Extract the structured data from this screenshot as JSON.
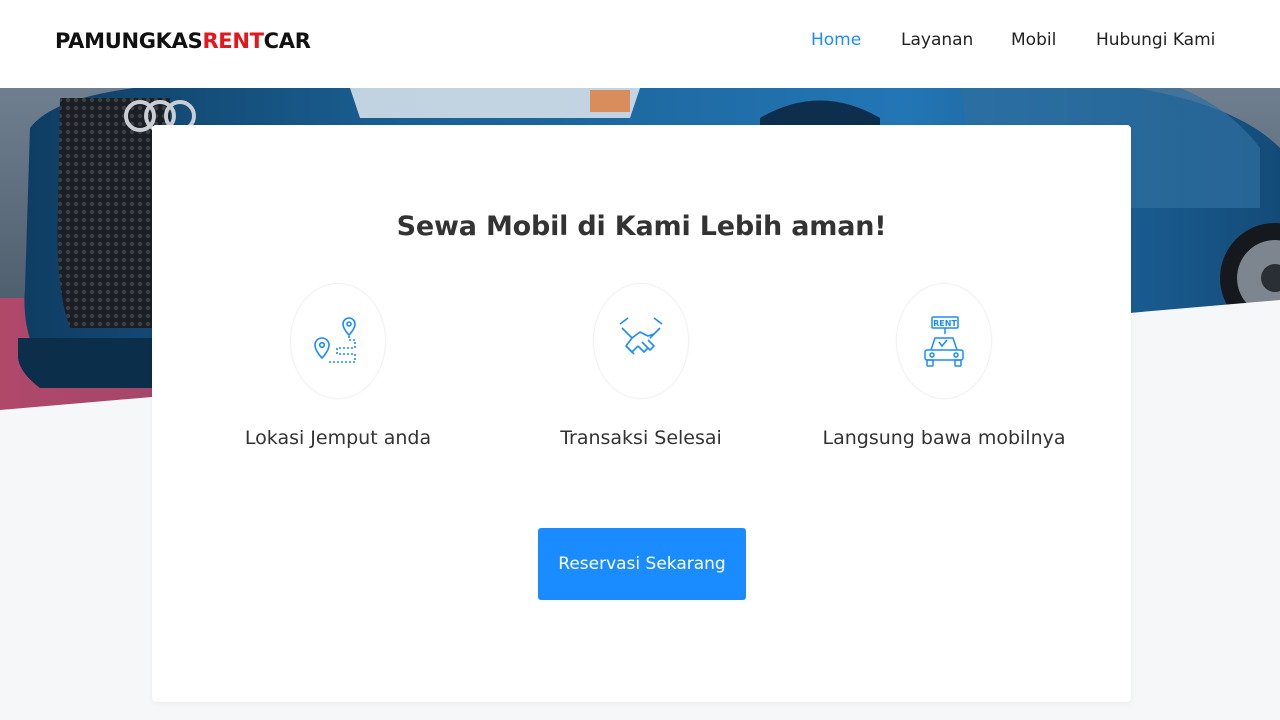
{
  "header": {
    "logo_part1": "PAMUNGKAS",
    "logo_part2": "RENT",
    "logo_part3": "CAR",
    "nav": {
      "home": "Home",
      "layanan": "Layanan",
      "mobil": "Mobil",
      "kontak": "Hubungi Kami"
    }
  },
  "main": {
    "title": "Sewa Mobil di Kami Lebih aman!",
    "features": [
      {
        "label": "Lokasi Jemput anda",
        "icon": "location-route-icon"
      },
      {
        "label": "Transaksi Selesai",
        "icon": "handshake-icon"
      },
      {
        "label": "Langsung bawa mobilnya",
        "icon": "rent-car-icon"
      }
    ],
    "cta_label": "Reservasi Sekarang",
    "rent_sign": "RENT"
  },
  "colors": {
    "accent": "#1a8cff",
    "logo_red": "#e5161c",
    "background": "#f6f7f9"
  }
}
